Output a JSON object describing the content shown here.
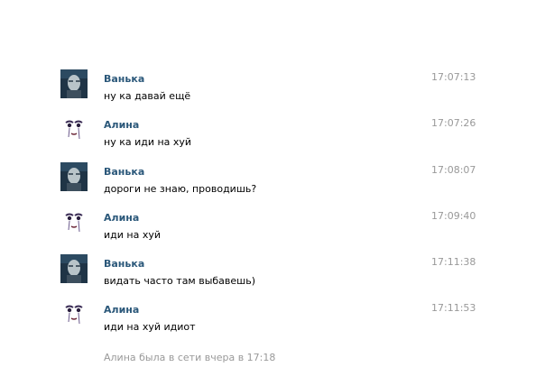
{
  "chat": {
    "messages": [
      {
        "author": "Ванька",
        "text": "ну ка давай ещё",
        "time": "17:07:13",
        "avatar_icon": "vanka-avatar"
      },
      {
        "author": "Алина",
        "text": "ну ка иди на хуй",
        "time": "17:07:26",
        "avatar_icon": "alina-avatar"
      },
      {
        "author": "Ванька",
        "text": "дороги не знаю, проводишь?",
        "time": "17:08:07",
        "avatar_icon": "vanka-avatar"
      },
      {
        "author": "Алина",
        "text": "иди на хуй",
        "time": "17:09:40",
        "avatar_icon": "alina-avatar"
      },
      {
        "author": "Ванька",
        "text": "видать часто там выбавешь)",
        "time": "17:11:38",
        "avatar_icon": "vanka-avatar"
      },
      {
        "author": "Алина",
        "text": "иди на хуй идиот",
        "time": "17:11:53",
        "avatar_icon": "alina-avatar"
      }
    ],
    "status": "Алина была в сети вчера в 17:18"
  },
  "colors": {
    "author": "#2b587a",
    "time": "#999999",
    "text": "#000000"
  }
}
